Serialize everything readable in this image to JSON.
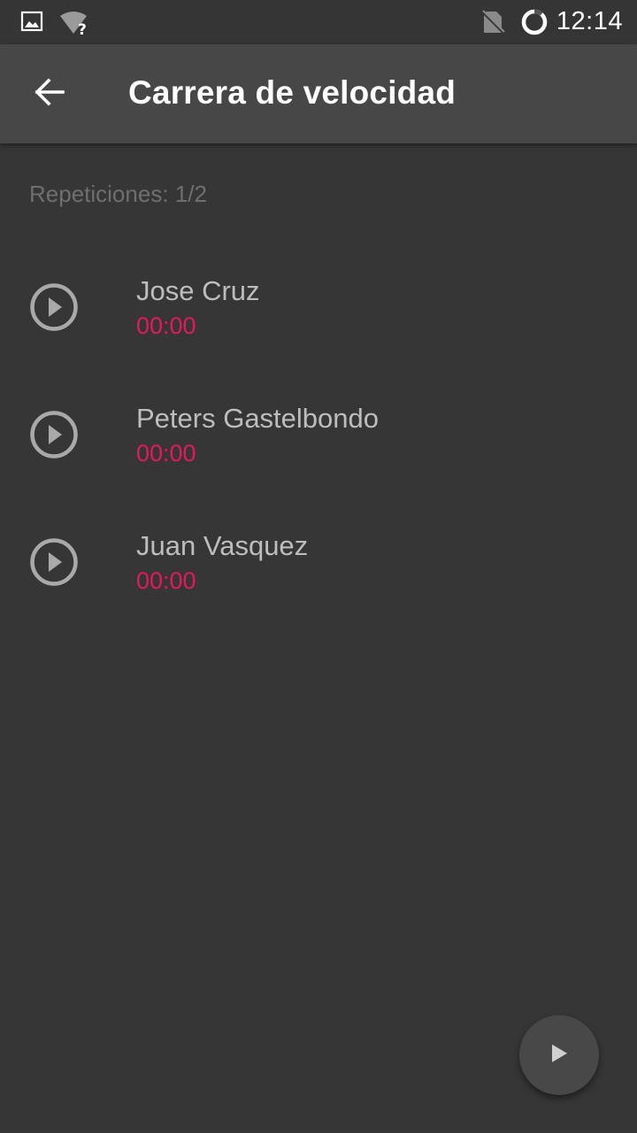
{
  "status_bar": {
    "time": "12:14",
    "icons": [
      "image-icon",
      "wifi-unknown-icon",
      "no-sim-icon",
      "sync-ring-icon"
    ]
  },
  "app_bar": {
    "back_icon": "arrow-left-icon",
    "title": "Carrera de velocidad"
  },
  "content": {
    "repetitions": "Repeticiones: 1/2",
    "runners": [
      {
        "name": "Jose Cruz",
        "time": "00:00"
      },
      {
        "name": "Peters Gastelbondo",
        "time": "00:00"
      },
      {
        "name": "Juan Vasquez",
        "time": "00:00"
      }
    ]
  },
  "fab": {
    "icon": "play-icon"
  },
  "colors": {
    "background": "#363636",
    "app_bar": "#474747",
    "accent_timer": "#e3195b",
    "text_primary": "#bdbdbd",
    "text_secondary": "#6f6f6f"
  }
}
